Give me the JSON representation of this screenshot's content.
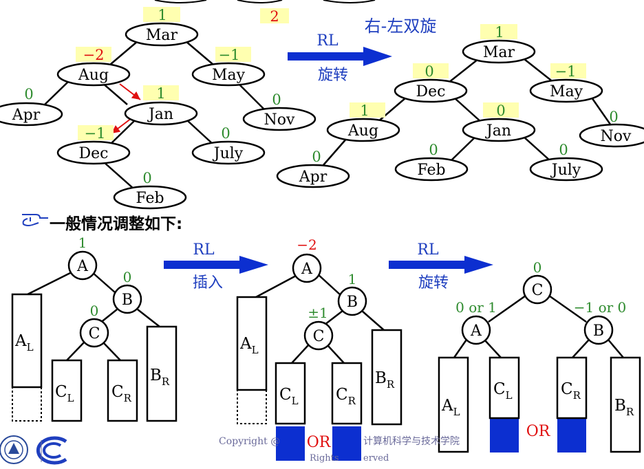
{
  "colors": {
    "black": "#000000",
    "green": "#2e8b2e",
    "red": "#e01010",
    "blue": "#1f3fbf",
    "arrow_blue": "#0c2fd0",
    "badge_bg": "#ffffb0",
    "fill_blue": "#0c2fd0",
    "gray_text": "#6a6a9a"
  },
  "top_left_tree": {
    "nodes": {
      "mar": "Mar",
      "aug": "Aug",
      "may": "May",
      "apr": "Apr",
      "jan": "Jan",
      "nov": "Nov",
      "dec": "Dec",
      "july": "July",
      "feb": "Feb"
    },
    "factors": {
      "mar": "1",
      "aug": "−2",
      "may": "−1",
      "apr": "0",
      "jan": "1",
      "nov": "0",
      "dec": "−1",
      "july": "0",
      "feb": "0",
      "top_right": "2"
    }
  },
  "rl_rotate_arrow": {
    "label": "RL",
    "caption": "旋转",
    "title": "右-左双旋"
  },
  "top_right_tree": {
    "nodes": {
      "mar": "Mar",
      "dec": "Dec",
      "may": "May",
      "aug": "Aug",
      "jan": "Jan",
      "nov": "Nov",
      "apr": "Apr",
      "feb": "Feb",
      "july": "July"
    },
    "factors": {
      "mar": "1",
      "dec": "0",
      "may": "−1",
      "aug": "1",
      "jan": "0",
      "nov": "0",
      "apr": "0",
      "feb": "0",
      "july": "0"
    }
  },
  "general_heading": "一般情况调整如下:",
  "hand_icon": "pointing-hand-icon",
  "general_1": {
    "a": "A",
    "b": "B",
    "c": "C",
    "f_a": "1",
    "f_b": "0",
    "f_c": "0",
    "al": "A",
    "al_sub": "L",
    "cl": "C",
    "cl_sub": "L",
    "cr": "C",
    "cr_sub": "R",
    "br": "B",
    "br_sub": "R"
  },
  "rl_insert_arrow": {
    "label": "RL",
    "caption": "插入"
  },
  "general_2": {
    "a": "A",
    "b": "B",
    "c": "C",
    "f_a": "−2",
    "f_b": "1",
    "f_c": "±1",
    "al": "A",
    "al_sub": "L",
    "cl": "C",
    "cl_sub": "L",
    "cr": "C",
    "cr_sub": "R",
    "br": "B",
    "br_sub": "R",
    "or": "OR"
  },
  "rl_rotate_arrow_2": {
    "label": "RL",
    "caption": "旋转"
  },
  "general_3": {
    "a": "A",
    "b": "B",
    "c": "C",
    "f_a": "0 or 1",
    "f_b": "−1 or 0",
    "f_c": "0",
    "al": "A",
    "al_sub": "L",
    "cl": "C",
    "cl_sub": "L",
    "cr": "C",
    "cr_sub": "R",
    "br": "B",
    "br_sub": "R",
    "or": "OR"
  },
  "footer": {
    "copyright": "Copyright @",
    "school": "计算机科学与技术学院",
    "rights": "Rights",
    "reserved": "erved"
  }
}
